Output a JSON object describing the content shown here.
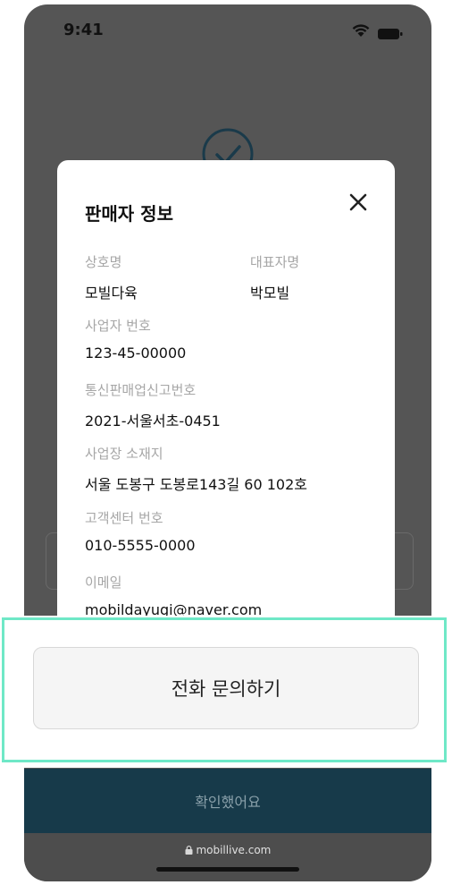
{
  "status_bar": {
    "time": "9:41"
  },
  "modal": {
    "title": "판매자 정보",
    "fields": [
      {
        "label": "상호명",
        "value": "모빌다육"
      },
      {
        "label": "대표자명",
        "value": "박모빌"
      },
      {
        "label": "사업자 번호",
        "value": "123-45-00000"
      },
      {
        "label": "통신판매업신고번호",
        "value": "2021-서울서초-0451"
      },
      {
        "label": "사업장 소재지",
        "value": "서울 도봉구 도봉로143길 60 102호"
      },
      {
        "label": "고객센터 번호",
        "value": "010-5555-0000"
      },
      {
        "label": "이메일",
        "value": "mobildayugi@naver.com"
      }
    ]
  },
  "actions": {
    "call_button": "전화 문의하기",
    "confirm_button": "확인했어요"
  },
  "browser": {
    "url": "mobillive.com"
  },
  "colors": {
    "highlight": "#6fe8c7",
    "confirm_bg": "#173a4a",
    "dim_bg": "#555555"
  }
}
